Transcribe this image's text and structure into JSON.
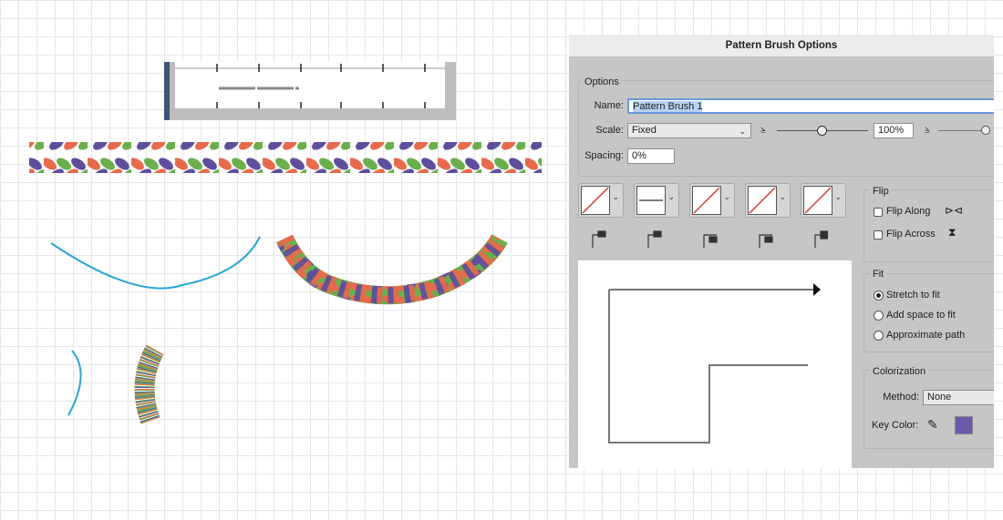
{
  "dialog": {
    "title": "Pattern Brush Options",
    "options_legend": "Options",
    "name_label": "Name:",
    "name_value": "Pattern Brush 1",
    "scale_label": "Scale:",
    "scale_value": "Fixed",
    "scale_percent": "100%",
    "spacing_label": "Spacing:",
    "spacing_value": "0%",
    "flip": {
      "legend": "Flip",
      "along": "Flip Along",
      "across": "Flip Across",
      "along_checked": false,
      "across_checked": false
    },
    "fit": {
      "legend": "Fit",
      "options": [
        "Stretch to fit",
        "Add space to fit",
        "Approximate path"
      ],
      "selected": "Stretch to fit"
    },
    "colorization": {
      "legend": "Colorization",
      "method_label": "Method:",
      "method_value": "None",
      "key_color_label": "Key Color:",
      "key_color": "#6b5aa8"
    }
  },
  "tile_icons": [
    "side-tile",
    "outer-corner-tile",
    "inner-corner-tile",
    "start-tile",
    "end-tile"
  ],
  "braid_colors": [
    "#e76a4c",
    "#5f4e9c",
    "#6aaf4c"
  ],
  "curve_color": "#2aa5d4"
}
